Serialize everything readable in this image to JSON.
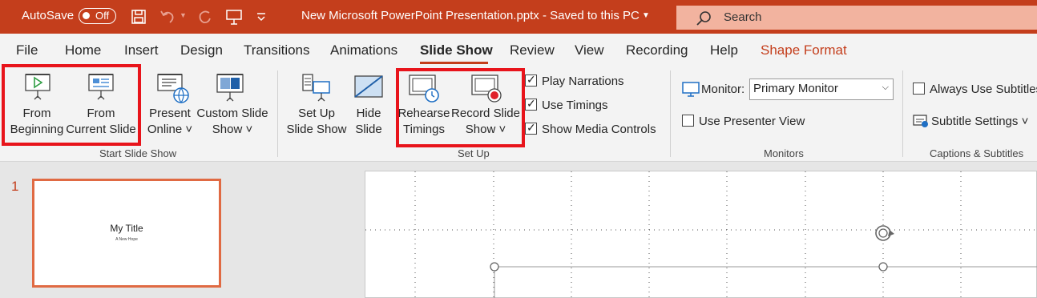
{
  "titlebar": {
    "autosave_label": "AutoSave",
    "autosave_state": "Off",
    "document_title": "New Microsoft PowerPoint Presentation.pptx  -  Saved to this PC",
    "search_placeholder": "Search",
    "color": "#c43e1c"
  },
  "tabs": [
    "File",
    "Home",
    "Insert",
    "Design",
    "Transitions",
    "Animations",
    "Slide Show",
    "Review",
    "View",
    "Recording",
    "Help",
    "Shape Format"
  ],
  "active_tab": "Slide Show",
  "ribbon": {
    "start": {
      "from_beginning": [
        "From",
        "Beginning"
      ],
      "from_current": [
        "From",
        "Current Slide"
      ],
      "present_online": [
        "Present",
        "Online ˅"
      ],
      "custom_show": [
        "Custom Slide",
        "Show ˅"
      ],
      "group_label": "Start Slide Show"
    },
    "setup": {
      "setup_show": [
        "Set Up",
        "Slide Show"
      ],
      "hide_slide": [
        "Hide",
        "Slide"
      ],
      "rehearse": [
        "Rehearse",
        "Timings"
      ],
      "record": [
        "Record Slide",
        "Show ˅"
      ],
      "play_narrations": "Play Narrations",
      "use_timings": "Use Timings",
      "show_media_controls": "Show Media Controls",
      "group_label": "Set Up"
    },
    "monitors": {
      "monitor_label": "Monitor:",
      "monitor_value": "Primary Monitor",
      "presenter_view": "Use Presenter View",
      "group_label": "Monitors"
    },
    "captions": {
      "always_subtitles": "Always Use Subtitles",
      "subtitle_settings": "Subtitle Settings ˅",
      "group_label": "Captions & Subtitles"
    }
  },
  "slides": {
    "number": "1",
    "title": "My Title",
    "subtitle": "A New Hope"
  }
}
